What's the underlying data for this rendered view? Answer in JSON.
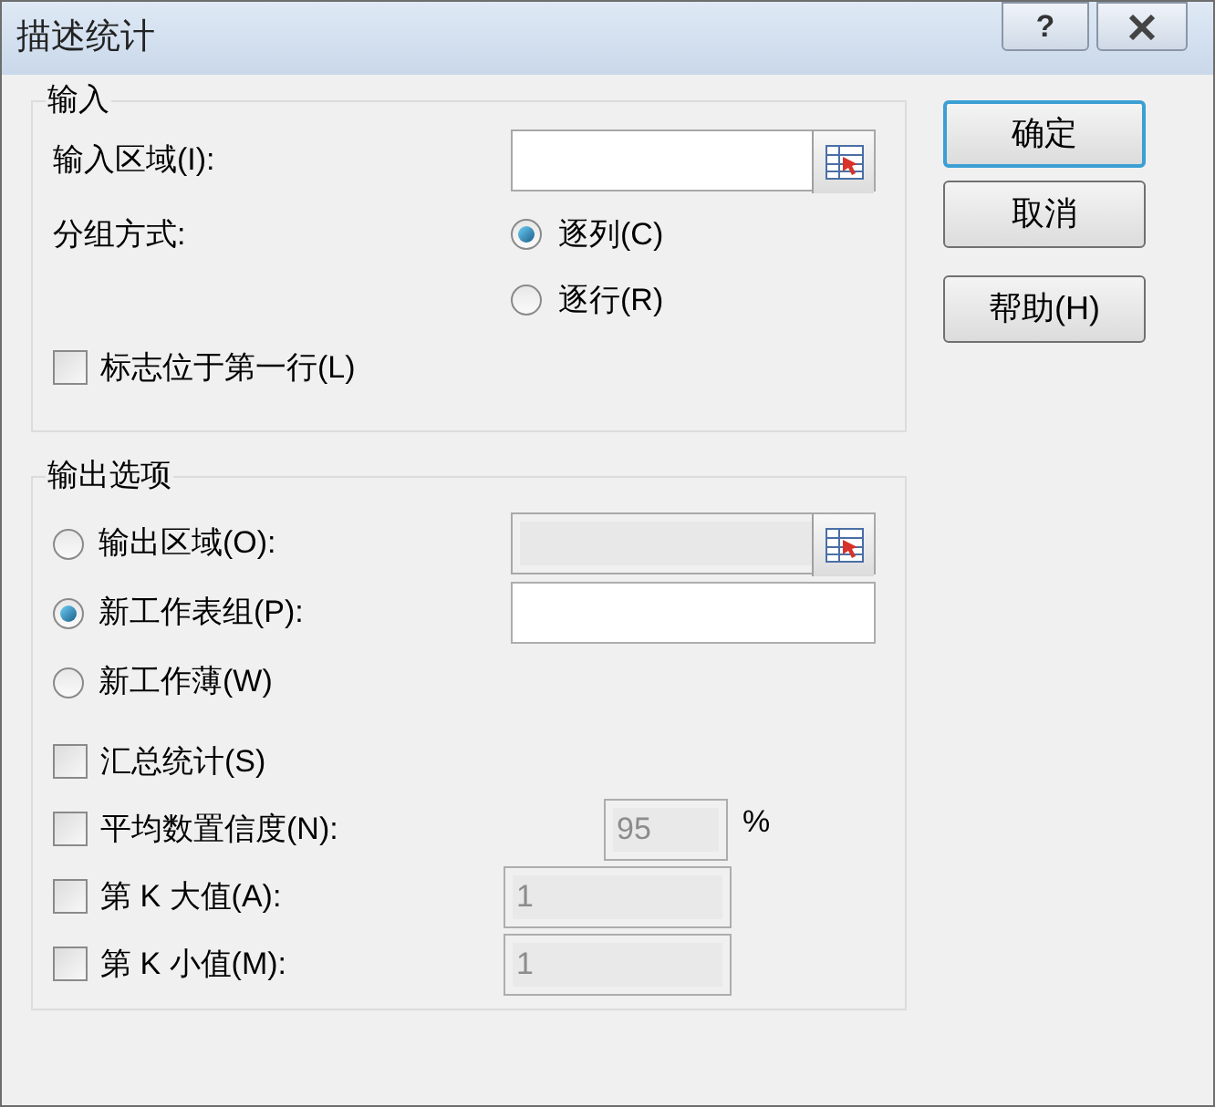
{
  "window": {
    "title": "描述统计",
    "help_button": "?"
  },
  "input_group": {
    "title": "输入",
    "range": {
      "label": "输入区域(I):"
    },
    "grouping": {
      "label": "分组方式:",
      "options": [
        {
          "label": "逐列(C)",
          "selected": true
        },
        {
          "label": "逐行(R)",
          "selected": false
        }
      ]
    },
    "labels_first_row": {
      "label": "标志位于第一行(L)",
      "checked": false
    }
  },
  "output_group": {
    "title": "输出选项",
    "destinations": [
      {
        "kind": "range",
        "label": "输出区域(O):",
        "selected": false,
        "field_disabled": true
      },
      {
        "kind": "field",
        "label": "新工作表组(P):",
        "selected": true,
        "field_disabled": false
      },
      {
        "kind": "none",
        "label": "新工作薄(W)",
        "selected": false
      }
    ],
    "statistics": [
      {
        "kind": "plain",
        "label": "汇总统计(S)",
        "checked": false
      },
      {
        "kind": "percent",
        "label": "平均数置信度(N):",
        "checked": false,
        "value": "95",
        "unit": "%",
        "disabled": true
      },
      {
        "kind": "number",
        "label": "第 K 大值(A):",
        "checked": false,
        "value": "1",
        "disabled": true
      },
      {
        "kind": "number",
        "label": "第 K 小值(M):",
        "checked": false,
        "value": "1",
        "disabled": true
      }
    ]
  },
  "buttons": [
    {
      "label": "确定",
      "default": true
    },
    {
      "label": "取消",
      "default": false
    },
    {
      "label": "帮助(H)",
      "default": false
    }
  ]
}
